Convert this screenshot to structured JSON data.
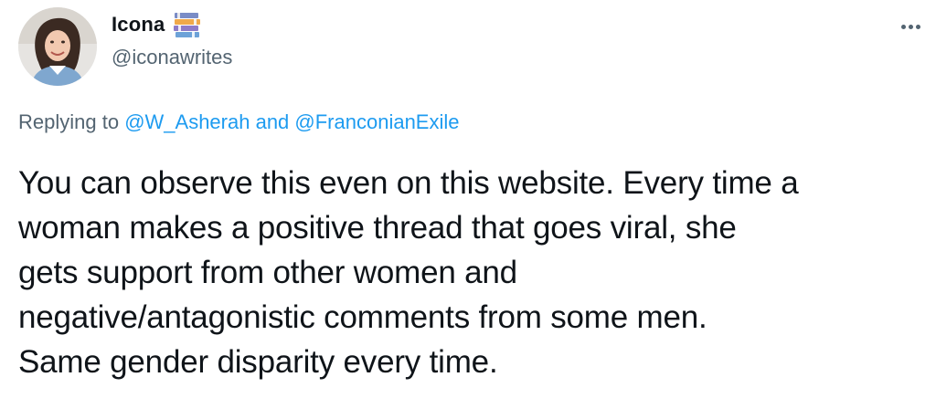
{
  "author": {
    "display_name": "Icona",
    "handle": "@iconawrites",
    "name_badge_icon": "books-emoji-icon",
    "avatar_icon": "profile-photo-avatar"
  },
  "menu": {
    "more_icon": "more-options-icon"
  },
  "reply_context": {
    "prefix": "Replying to ",
    "mentions": [
      "@W_Asherah",
      "@FranconianExile"
    ],
    "joiner": " and "
  },
  "tweet": {
    "lines": [
      "You can observe this even on this website. Every time a",
      "woman makes a positive thread that goes viral, she",
      "gets support from other women and",
      "negative/antagonistic comments from some men.",
      "Same gender disparity every time."
    ]
  },
  "colors": {
    "text": "#0f1419",
    "secondary": "#536471",
    "link": "#1d9bf0"
  }
}
